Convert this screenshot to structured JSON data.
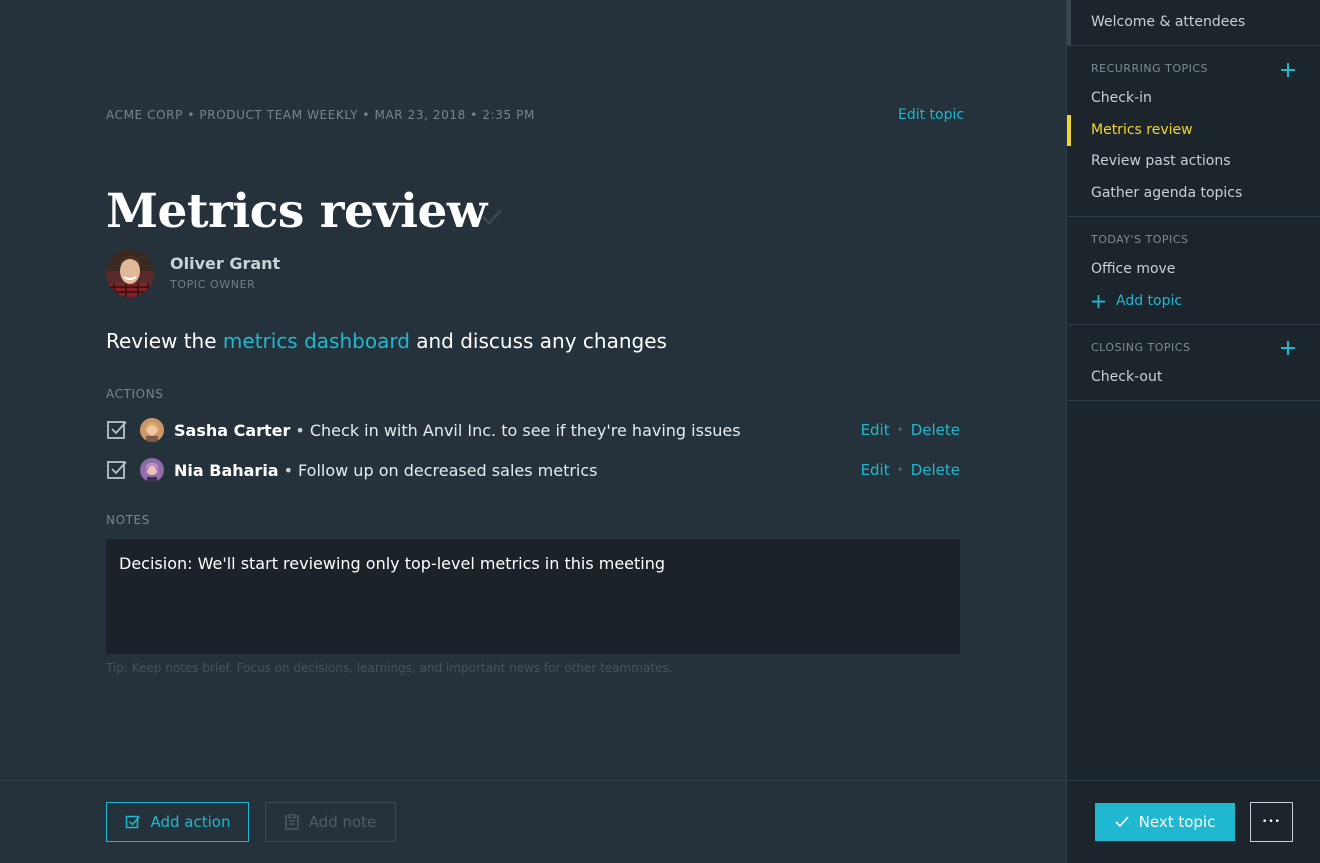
{
  "header": {
    "breadcrumb": "ACME CORP • PRODUCT TEAM WEEKLY • MAR 23, 2018 • 2:35 PM",
    "edit_topic_label": "Edit topic"
  },
  "topic": {
    "title": "Metrics review",
    "owner_name": "Oliver Grant",
    "owner_role": "TOPIC OWNER",
    "description_before": "Review the ",
    "description_link": "metrics dashboard",
    "description_after": " and discuss any changes"
  },
  "actions": {
    "label": "ACTIONS",
    "items": [
      {
        "name": "Sasha Carter",
        "text": "Check in with Anvil Inc. to see if they're having issues",
        "edit": "Edit",
        "delete": "Delete"
      },
      {
        "name": "Nia Baharia",
        "text": "Follow up on decreased sales metrics",
        "edit": "Edit",
        "delete": "Delete"
      }
    ]
  },
  "notes": {
    "label": "NOTES",
    "content": "Decision: We'll start reviewing only top-level metrics in this meeting",
    "tip": "Tip: Keep notes brief. Focus on decisions, learnings, and important news for other teammates."
  },
  "footer": {
    "add_action_label": "Add action",
    "add_note_label": "Add note"
  },
  "sidebar": {
    "welcome": "Welcome & attendees",
    "recurring_label": "RECURRING TOPICS",
    "recurring": [
      "Check-in",
      "Metrics review",
      "Review past actions",
      "Gather agenda topics"
    ],
    "todays_label": "TODAY'S TOPICS",
    "todays": [
      "Office move"
    ],
    "add_topic_label": "Add topic",
    "closing_label": "CLOSING TOPICS",
    "closing": [
      "Check-out"
    ],
    "next_topic_label": "Next topic",
    "more_label": "•••"
  },
  "colors": {
    "accent": "#1fb8d0",
    "active": "#f3d531",
    "main_bg": "#26323b",
    "sidebar_bg": "#1c252c"
  },
  "icons": [
    "check-icon",
    "checkbox-icon",
    "plus-icon",
    "clipboard-icon",
    "more-icon"
  ]
}
